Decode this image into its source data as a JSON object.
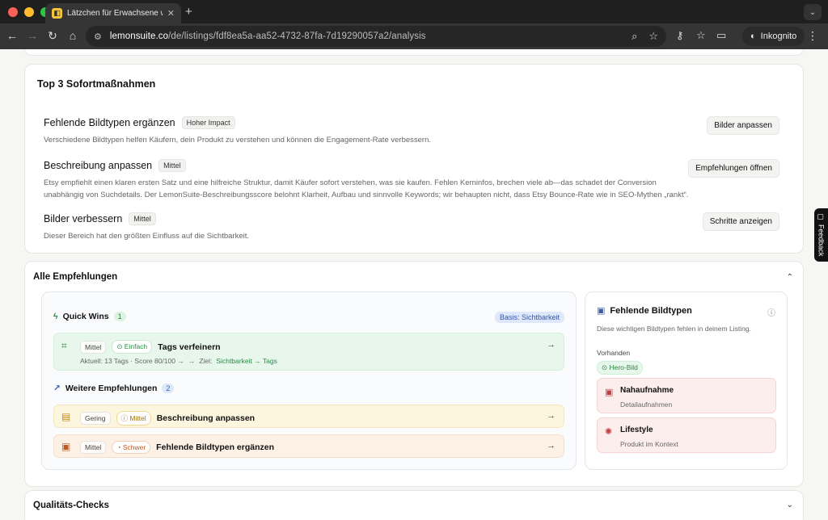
{
  "browser": {
    "tab_title": "Lätzchen für Erwachsene wit",
    "url_host": "lemonsuite.co",
    "url_path": "/de/listings/fdf8ea5a-aa52-4732-87fa-7d19290057a2/analysis",
    "incognito_label": "Inkognito"
  },
  "sofort": {
    "heading": "Top 3 Sofortmaßnahmen",
    "items": [
      {
        "title": "Fehlende Bildtypen ergänzen",
        "badge": "Hoher Impact",
        "desc": "Verschiedene Bildtypen helfen Käufern, dein Produkt zu verstehen und können die Engagement-Rate verbessern.",
        "button": "Bilder anpassen"
      },
      {
        "title": "Beschreibung anpassen",
        "badge": "Mittel",
        "desc": "Etsy empfiehlt einen klaren ersten Satz und eine hilfreiche Struktur, damit Käufer sofort verstehen, was sie kaufen. Fehlen Kerninfos, brechen viele ab—das schadet der Conversion unabhängig von Suchdetails. Der LemonSuite-Beschreibungsscore belohnt Klarheit, Aufbau und sinnvolle Keywords; wir behaupten nicht, dass Etsy Bounce-Rate wie in SEO-Mythen „rankt“.",
        "button": "Empfehlungen öffnen"
      },
      {
        "title": "Bilder verbessern",
        "badge": "Mittel",
        "desc": "Dieser Bereich hat den größten Einfluss auf die Sichtbarkeit.",
        "button": "Schritte anzeigen"
      }
    ]
  },
  "alle": {
    "heading": "Alle Empfehlungen",
    "quick_wins": {
      "label": "Quick Wins",
      "count": "1",
      "basis": "Basis: Sichtbarkeit",
      "row": {
        "impact": "Mittel",
        "effort": "Einfach",
        "title": "Tags verfeinern",
        "current": "Aktuell: 13 Tags · Score 80/100 →",
        "arrow": "→",
        "goal_label": "Ziel:",
        "goal": "Sichtbarkeit → Tags"
      }
    },
    "weitere": {
      "label": "Weitere Empfehlungen",
      "count": "2",
      "rows": [
        {
          "impact": "Gering",
          "effort": "Mittel",
          "title": "Beschreibung anpassen"
        },
        {
          "impact": "Mittel",
          "effort": "Schwer",
          "title": "Fehlende Bildtypen ergänzen"
        }
      ]
    },
    "side": {
      "title": "Fehlende Bildtypen",
      "desc": "Diese wichtigen Bildtypen fehlen in deinem Listing.",
      "present_label": "Vorhanden",
      "present_item": "Hero-Bild",
      "missing": [
        {
          "title": "Nahaufnahme",
          "sub": "Detailaufnahmen"
        },
        {
          "title": "Lifestyle",
          "sub": "Produkt im Kontext"
        }
      ]
    }
  },
  "qual": {
    "heading": "Qualitäts-Checks"
  },
  "feedback": {
    "label": "Feedback"
  }
}
